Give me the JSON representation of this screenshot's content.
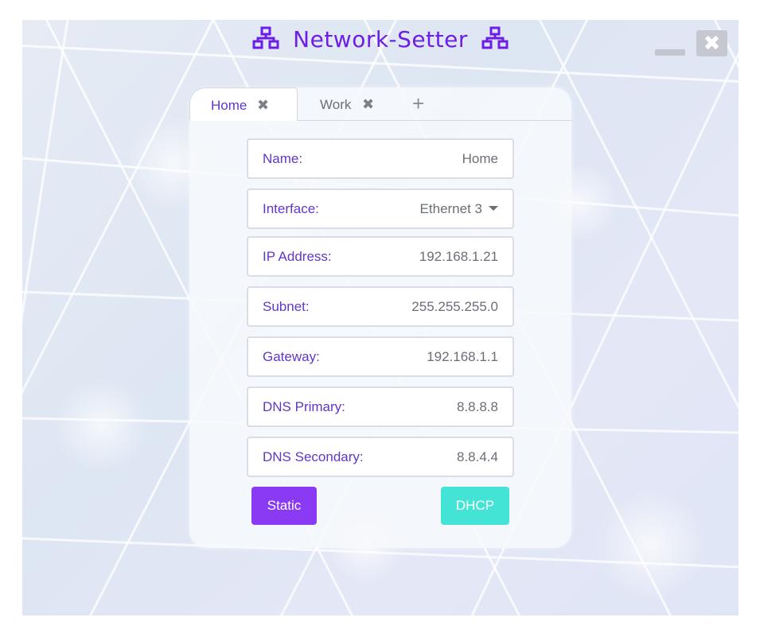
{
  "app": {
    "title": "Network-Setter",
    "title_icon": "network-icon",
    "minimize_icon": "minimize-icon",
    "close_icon": "close-icon",
    "close_glyph": "✖"
  },
  "colors": {
    "accent": "#6d1ee6",
    "label": "#6236c9",
    "static_button": "#8b3af3",
    "dhcp_button": "#43e3d5"
  },
  "tabs": [
    {
      "label": "Home",
      "close_glyph": "✖",
      "active": true
    },
    {
      "label": "Work",
      "close_glyph": "✖",
      "active": false
    }
  ],
  "add_tab_glyph": "+",
  "form": {
    "name": {
      "label": "Name:",
      "value": "Home"
    },
    "interface": {
      "label": "Interface:",
      "value": "Ethernet 3"
    },
    "ip": {
      "label": "IP Address:",
      "value": "192.168.1.21"
    },
    "subnet": {
      "label": "Subnet:",
      "value": "255.255.255.0"
    },
    "gateway": {
      "label": "Gateway:",
      "value": "192.168.1.1"
    },
    "dns1": {
      "label": "DNS Primary:",
      "value": "8.8.8.8"
    },
    "dns2": {
      "label": "DNS Secondary:",
      "value": "8.8.4.4"
    }
  },
  "buttons": {
    "static": "Static",
    "dhcp": "DHCP"
  }
}
